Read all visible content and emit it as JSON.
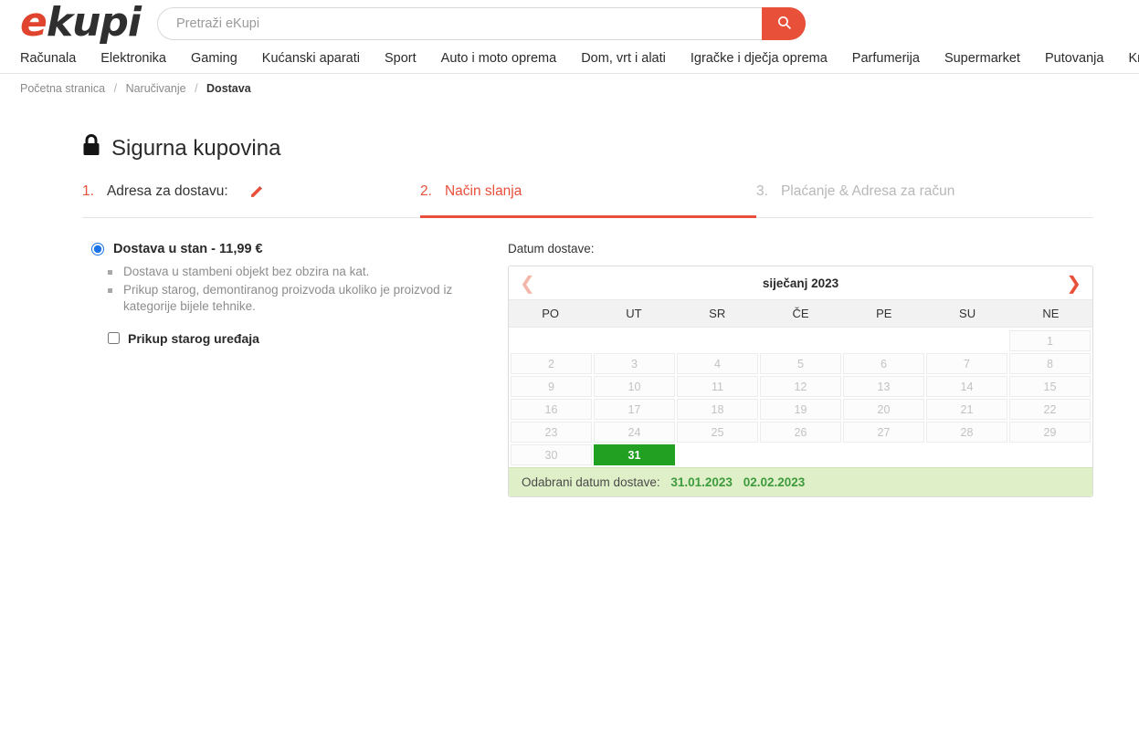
{
  "brand": {
    "logo_first": "e",
    "logo_rest": "kupi",
    "accent_color": "#e8503a",
    "logo_color": "#e0442e"
  },
  "search": {
    "placeholder": "Pretraži eKupi",
    "value": "",
    "button_icon": "search-icon"
  },
  "nav": {
    "items": [
      {
        "label": "Računala"
      },
      {
        "label": "Elektronika"
      },
      {
        "label": "Gaming"
      },
      {
        "label": "Kućanski aparati"
      },
      {
        "label": "Sport"
      },
      {
        "label": "Auto i moto oprema"
      },
      {
        "label": "Dom, vrt i alati"
      },
      {
        "label": "Igračke i dječja oprema"
      },
      {
        "label": "Parfumerija"
      },
      {
        "label": "Supermarket"
      },
      {
        "label": "Putovanja"
      },
      {
        "label": "Knjige"
      }
    ]
  },
  "breadcrumb": {
    "home": "Početna stranica",
    "sep": "/",
    "level2": "Naručivanje",
    "current": "Dostava"
  },
  "page": {
    "title": "Sigurna kupovina",
    "lock_icon": "lock-icon"
  },
  "steps": [
    {
      "num": "1.",
      "label": "Adresa za dostavu:",
      "state": "completed",
      "edit_icon": "pencil-icon"
    },
    {
      "num": "2.",
      "label": "Način slanja",
      "state": "active"
    },
    {
      "num": "3.",
      "label": "Plaćanje & Adresa za račun",
      "state": "disabled"
    }
  ],
  "shipping": {
    "option_title": "Dostava u stan - 11,99 €",
    "option_selected": true,
    "bullets": [
      "Dostava u stambeni objekt bez obzira na kat.",
      "Prikup starog, demontiranog proizvoda ukoliko je proizvod iz kategorije bijele tehnike."
    ],
    "pickup_label": "Prikup starog uređaja",
    "pickup_checked": false
  },
  "calendar": {
    "label": "Datum dostave:",
    "month": "siječanj 2023",
    "prev_icon": "chevron-left-icon",
    "next_icon": "chevron-right-icon",
    "weekdays": [
      "PO",
      "UT",
      "SR",
      "ČE",
      "PE",
      "SU",
      "NE"
    ],
    "leading_blanks": 6,
    "days": [
      {
        "n": "1",
        "state": "disabled"
      },
      {
        "n": "2",
        "state": "disabled"
      },
      {
        "n": "3",
        "state": "disabled"
      },
      {
        "n": "4",
        "state": "disabled"
      },
      {
        "n": "5",
        "state": "disabled"
      },
      {
        "n": "6",
        "state": "disabled"
      },
      {
        "n": "7",
        "state": "disabled"
      },
      {
        "n": "8",
        "state": "disabled"
      },
      {
        "n": "9",
        "state": "disabled"
      },
      {
        "n": "10",
        "state": "disabled"
      },
      {
        "n": "11",
        "state": "disabled"
      },
      {
        "n": "12",
        "state": "disabled"
      },
      {
        "n": "13",
        "state": "disabled"
      },
      {
        "n": "14",
        "state": "disabled"
      },
      {
        "n": "15",
        "state": "disabled"
      },
      {
        "n": "16",
        "state": "disabled"
      },
      {
        "n": "17",
        "state": "disabled"
      },
      {
        "n": "18",
        "state": "disabled"
      },
      {
        "n": "19",
        "state": "disabled"
      },
      {
        "n": "20",
        "state": "disabled"
      },
      {
        "n": "21",
        "state": "disabled"
      },
      {
        "n": "22",
        "state": "disabled"
      },
      {
        "n": "23",
        "state": "disabled"
      },
      {
        "n": "24",
        "state": "disabled"
      },
      {
        "n": "25",
        "state": "disabled"
      },
      {
        "n": "26",
        "state": "disabled"
      },
      {
        "n": "27",
        "state": "disabled"
      },
      {
        "n": "28",
        "state": "disabled"
      },
      {
        "n": "29",
        "state": "disabled"
      },
      {
        "n": "30",
        "state": "disabled"
      },
      {
        "n": "31",
        "state": "selected"
      }
    ],
    "footer_label": "Odabrani datum dostave:",
    "footer_date_1": "31.01.2023",
    "footer_date_2": "02.02.2023",
    "selected_color": "#22a022",
    "footer_bg": "#dff0c8"
  }
}
